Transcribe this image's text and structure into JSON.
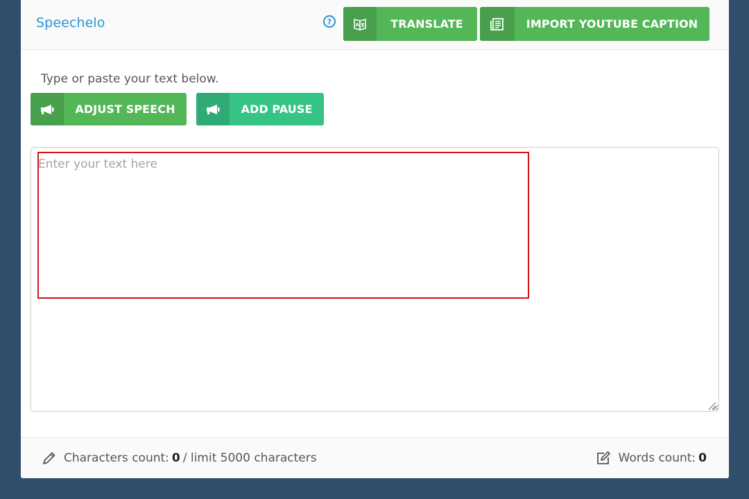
{
  "header": {
    "brand": "Speechelo",
    "help_icon": "question-circle-icon",
    "translate_label": "TRANSLATE",
    "translate_icon": "translate-book-icon",
    "import_label": "IMPORT YOUTUBE CAPTION",
    "import_icon": "document-icon"
  },
  "editor": {
    "hint": "Type or paste your text below.",
    "adjust_label": "ADJUST SPEECH",
    "adjust_icon": "megaphone-icon",
    "pause_label": "ADD PAUSE",
    "pause_icon": "megaphone-icon",
    "placeholder": "Enter your text here",
    "value": ""
  },
  "footer": {
    "chars_prefix": "Characters count:",
    "chars_count": "0",
    "chars_suffix": "/ limit 5000 characters",
    "words_prefix": "Words count:",
    "words_count": "0"
  },
  "colors": {
    "background": "#2f4e6b",
    "brand": "#2d93d1",
    "green_button": "#53b758",
    "teal_button": "#36c486",
    "highlight": "#d5121b"
  }
}
